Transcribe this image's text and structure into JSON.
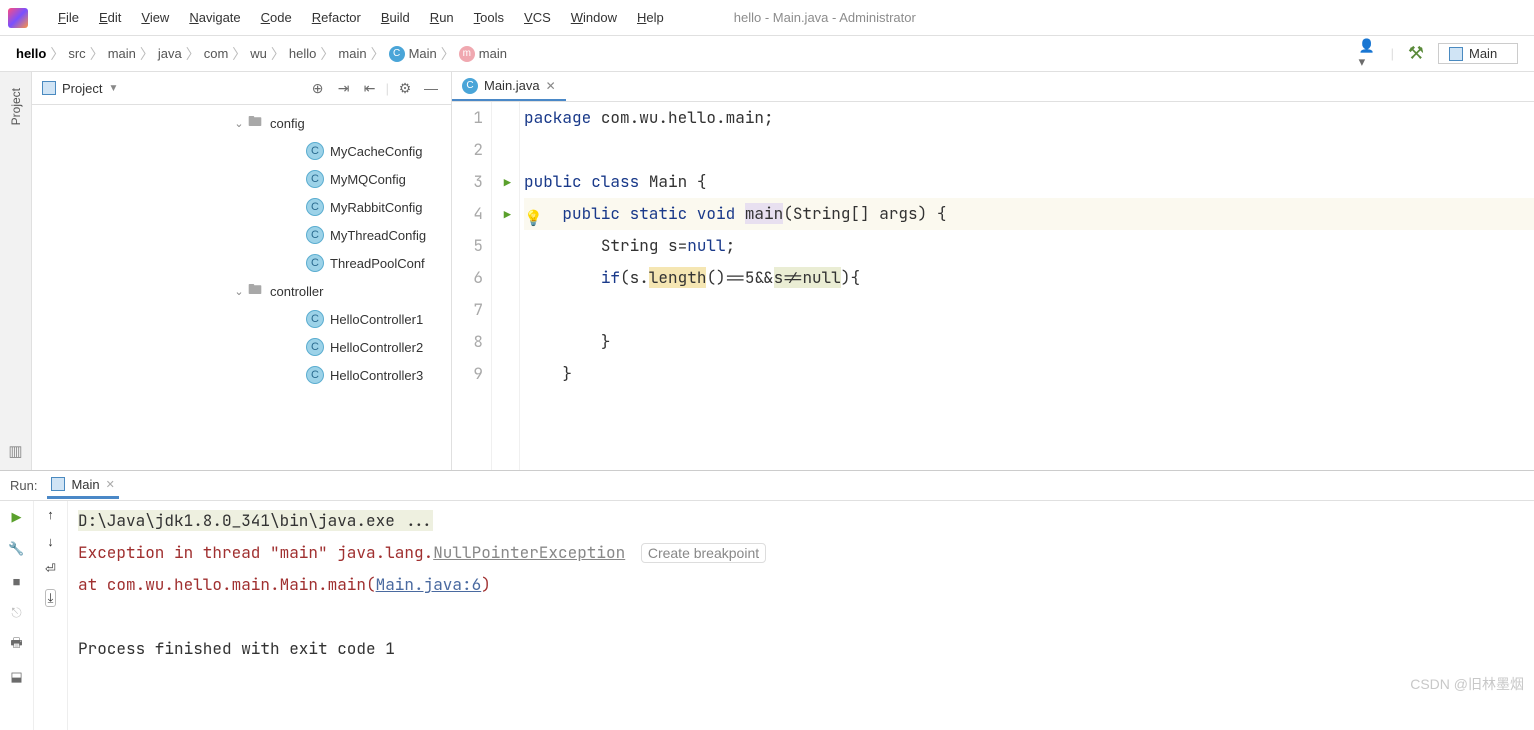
{
  "window_title": "hello - Main.java - Administrator",
  "menu": [
    "File",
    "Edit",
    "View",
    "Navigate",
    "Code",
    "Refactor",
    "Build",
    "Run",
    "Tools",
    "VCS",
    "Window",
    "Help"
  ],
  "breadcrumb": [
    "hello",
    "src",
    "main",
    "java",
    "com",
    "wu",
    "hello",
    "main",
    "Main",
    "main"
  ],
  "toolbar_config": "Main",
  "project_pane": {
    "title": "Project",
    "tree": [
      {
        "type": "folder",
        "label": "config",
        "indent": 1,
        "expanded": true
      },
      {
        "type": "class",
        "label": "MyCacheConfig",
        "indent": 2
      },
      {
        "type": "class",
        "label": "MyMQConfig",
        "indent": 2
      },
      {
        "type": "class",
        "label": "MyRabbitConfig",
        "indent": 2
      },
      {
        "type": "class",
        "label": "MyThreadConfig",
        "indent": 2
      },
      {
        "type": "class",
        "label": "ThreadPoolConf",
        "indent": 2
      },
      {
        "type": "folder",
        "label": "controller",
        "indent": 1,
        "expanded": true
      },
      {
        "type": "class",
        "label": "HelloController1",
        "indent": 2
      },
      {
        "type": "class",
        "label": "HelloController2",
        "indent": 2
      },
      {
        "type": "class",
        "label": "HelloController3",
        "indent": 2
      }
    ]
  },
  "editor": {
    "tab": "Main.java",
    "lines": {
      "1": {
        "pre": "",
        "segs": [
          {
            "t": "package ",
            "c": "kw"
          },
          {
            "t": "com.wu.hello.main;"
          }
        ]
      },
      "2": {
        "pre": "",
        "segs": []
      },
      "3": {
        "pre": "",
        "run": true,
        "segs": [
          {
            "t": "public class ",
            "c": "kw"
          },
          {
            "t": "Main {"
          }
        ]
      },
      "4": {
        "pre": "    ",
        "run": true,
        "hl": true,
        "segs": [
          {
            "t": "public static void ",
            "c": "kw"
          },
          {
            "t": "main",
            "c": "id-hl"
          },
          {
            "t": "(String[] args) {"
          }
        ]
      },
      "5": {
        "pre": "        ",
        "segs": [
          {
            "t": "String s="
          },
          {
            "t": "null",
            "c": "kw"
          },
          {
            "t": ";"
          }
        ]
      },
      "6": {
        "pre": "        ",
        "segs": [
          {
            "t": "if",
            "c": "kw"
          },
          {
            "t": "(s."
          },
          {
            "t": "length",
            "c": "warn-hl"
          },
          {
            "t": "()==5&&"
          },
          {
            "t": "s!=",
            "c": "str-warn"
          },
          {
            "t": "null",
            "c": "str-warn"
          },
          {
            "t": "){"
          }
        ]
      },
      "7": {
        "pre": "",
        "segs": []
      },
      "8": {
        "pre": "        ",
        "segs": [
          {
            "t": "}"
          }
        ]
      },
      "9": {
        "pre": "    ",
        "segs": [
          {
            "t": "}"
          }
        ]
      }
    }
  },
  "run_panel": {
    "label": "Run:",
    "tab": "Main",
    "console": {
      "cmd": "D:\\Java\\jdk1.8.0_341\\bin\\java.exe ...",
      "exc_prefix": "Exception in thread \"main\" java.lang.",
      "exc_name": "NullPointerException",
      "hint": "Create breakpoint",
      "at_prefix": "    at com.wu.hello.main.Main.main(",
      "at_link": "Main.java:6",
      "at_suffix": ")",
      "exit": "Process finished with exit code 1"
    }
  },
  "left_tab": "Project",
  "watermark": "CSDN @旧林墨烟"
}
